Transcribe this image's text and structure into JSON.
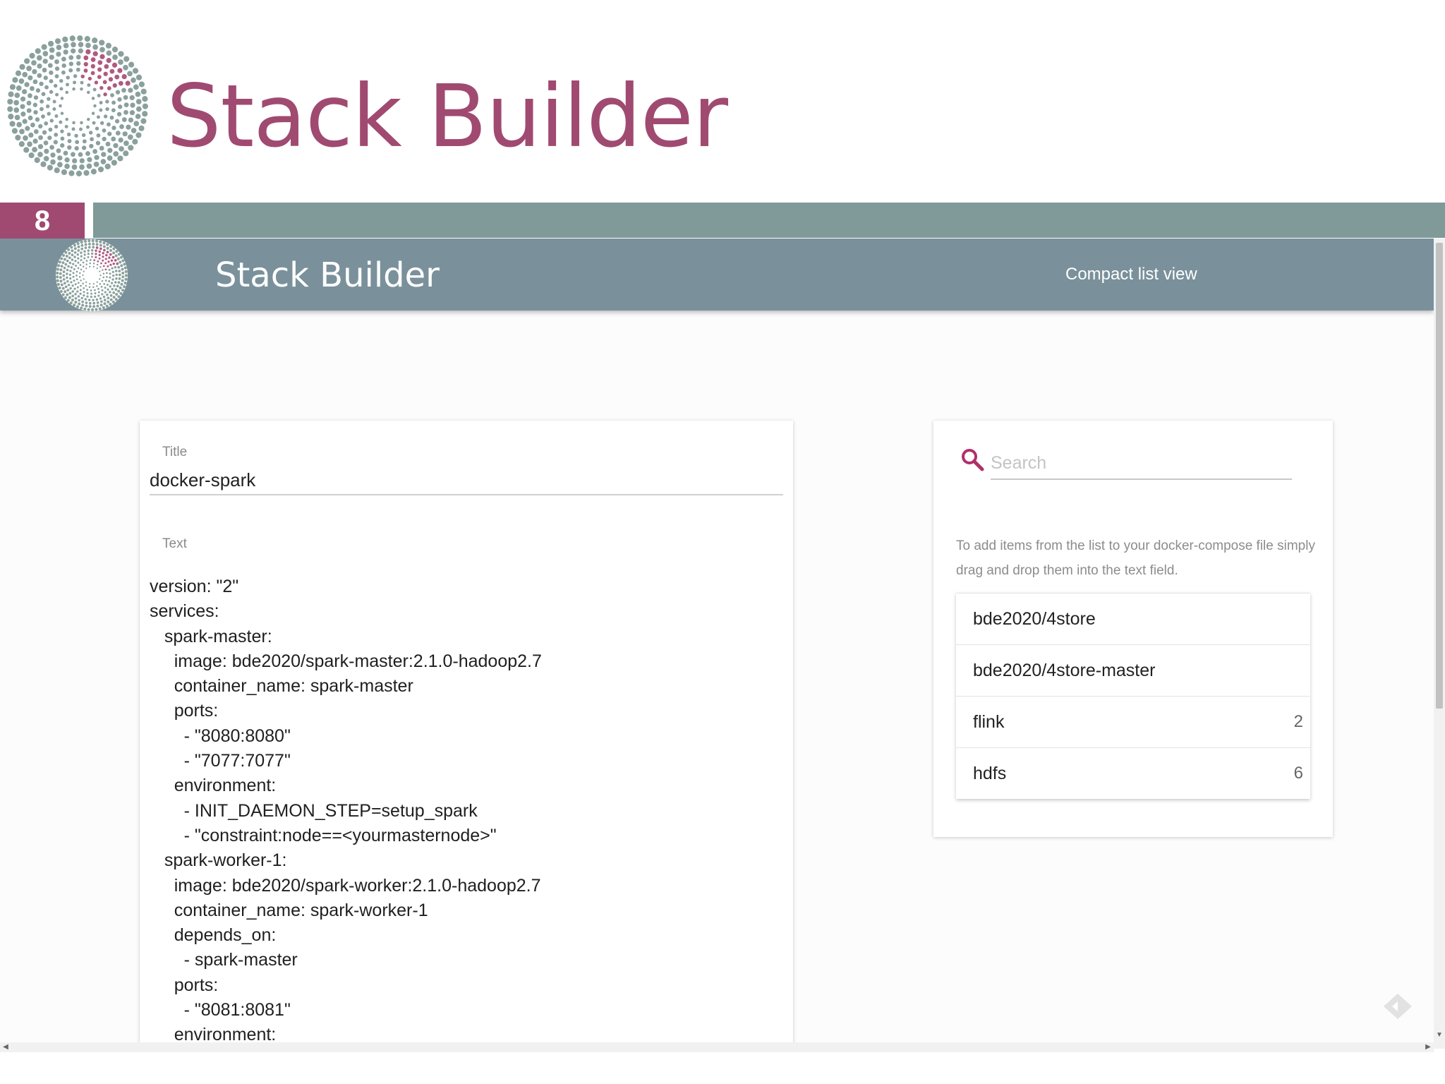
{
  "slide": {
    "title": "Stack Builder",
    "page_number": "8"
  },
  "app": {
    "title": "Stack Builder",
    "compact_view_label": "Compact list view"
  },
  "editor": {
    "title_label": "Title",
    "title_value": "docker-spark",
    "text_label": "Text",
    "text_value": "version: \"2\"\nservices:\n   spark-master:\n     image: bde2020/spark-master:2.1.0-hadoop2.7\n     container_name: spark-master\n     ports:\n       - \"8080:8080\"\n       - \"7077:7077\"\n     environment:\n       - INIT_DAEMON_STEP=setup_spark\n       - \"constraint:node==<yourmasternode>\"\n   spark-worker-1:\n     image: bde2020/spark-worker:2.1.0-hadoop2.7\n     container_name: spark-worker-1\n     depends_on:\n       - spark-master\n     ports:\n       - \"8081:8081\"\n     environment:"
  },
  "search": {
    "placeholder": "Search",
    "help_text": "To add items from the list to your docker-compose file simply drag and drop them into the text field."
  },
  "image_list": [
    {
      "label": "bde2020/4store",
      "count": ""
    },
    {
      "label": "bde2020/4store-master",
      "count": ""
    },
    {
      "label": "flink",
      "count": "2"
    },
    {
      "label": "hdfs",
      "count": "6"
    }
  ],
  "icons": {
    "logo": "dotted-spiral-logo",
    "search": "search-icon",
    "corner": "diamond-icon"
  },
  "colors": {
    "brand": "#a04a71",
    "toolbar": "#7a919b",
    "slide_bar": "#7f9a99",
    "logo_dots": "#8aa09c",
    "logo_accent": "#b05a80",
    "search_icon": "#b0306a"
  }
}
